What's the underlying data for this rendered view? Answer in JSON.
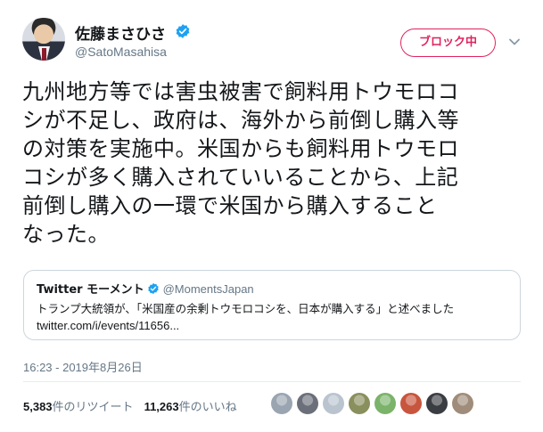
{
  "author": {
    "name": "佐藤まさひさ",
    "handle": "@SatoMasahisa",
    "verified_color": "#1da1f2"
  },
  "actions": {
    "block_label": "ブロック中",
    "block_color": "#e0245e"
  },
  "tweet": {
    "lines": [
      "九州地方等では害虫被害で飼料用トウモロコ",
      "シが不足し、政府は、海外から前倒し購入等",
      "の対策を実施中。米国からも飼料用トウモロ",
      "コシが多く購入されていいることから、上記",
      "前倒し購入の一環で米国から購入すること",
      "なった。"
    ]
  },
  "quoted_card": {
    "source": "Twitter モーメント",
    "handle": "@MomentsJapan",
    "text": "トランプ大統領が、「米国産の余剰トウモロコシを、日本が購入する」と述べました",
    "link": "twitter.com/i/events/11656..."
  },
  "timestamp": "16:23 - 2019年8月26日",
  "stats": {
    "retweets_count": "5,383",
    "retweets_label": "件のリツイート",
    "likes_count": "11,263",
    "likes_label": "件のいいね"
  },
  "likers": {
    "colors": [
      "#9aa5b1",
      "#6b6f7a",
      "#b9c4cf",
      "#8a8f5e",
      "#7bb36a",
      "#c8553d",
      "#3a3d42",
      "#a08c7a"
    ]
  }
}
